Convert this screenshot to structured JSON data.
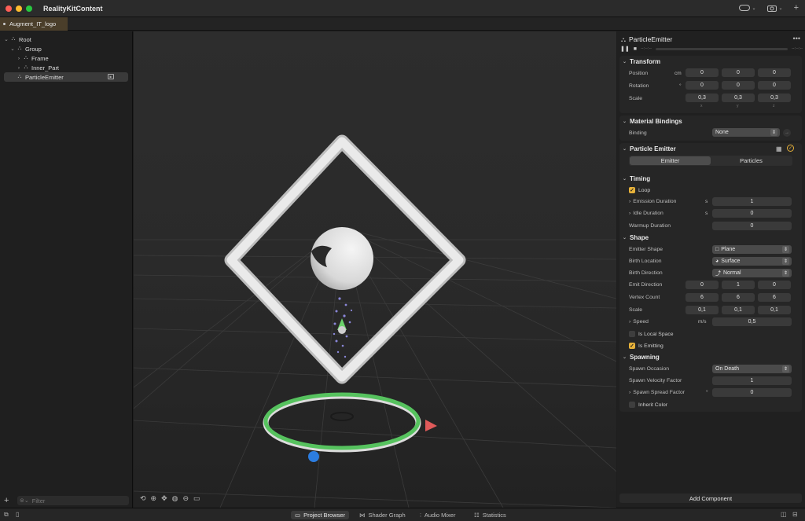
{
  "window": {
    "title": "RealityKitContent",
    "colors": {
      "close": "#ff5f57",
      "minimize": "#febc2e",
      "zoom": "#28c840",
      "accent": "#e6b13a",
      "tab_bg": "#4a3e2a"
    },
    "toolbar_icons": [
      "vr-headset-icon",
      "camera-icon",
      "plus-icon"
    ]
  },
  "tab": {
    "label": "Augment_IT_logo"
  },
  "hierarchy": {
    "items": [
      {
        "label": "Root",
        "expanded": true,
        "icon": "entity-icon"
      },
      {
        "label": "Group",
        "expanded": true,
        "icon": "entity-icon"
      },
      {
        "label": "Frame",
        "expanded": false,
        "icon": "entity-icon"
      },
      {
        "label": "Inner_Part",
        "expanded": false,
        "icon": "model-icon"
      },
      {
        "label": "ParticleEmitter",
        "selected": true,
        "icon": "entity-icon"
      }
    ],
    "filter_placeholder": "Filter"
  },
  "viewport": {
    "tools": [
      "orbit-icon",
      "move-icon",
      "pan-icon",
      "globe-icon",
      "zoom-icon",
      "camera-icon"
    ]
  },
  "inspector": {
    "title": "ParticleEmitter",
    "time_start": "--:--:--",
    "time_end": "--:--:--",
    "transform": {
      "title": "Transform",
      "position": {
        "label": "Position",
        "unit": "cm",
        "values": [
          "0",
          "0",
          "0"
        ]
      },
      "rotation": {
        "label": "Rotation",
        "unit": "°",
        "values": [
          "0",
          "0",
          "0"
        ]
      },
      "scale": {
        "label": "Scale",
        "values": [
          "0,3",
          "0,3",
          "0,3"
        ]
      },
      "axes": [
        "x",
        "y",
        "z"
      ]
    },
    "material": {
      "title": "Material Bindings",
      "binding_label": "Binding",
      "binding_value": "None"
    },
    "particle": {
      "title": "Particle Emitter",
      "segments": [
        "Emitter",
        "Particles"
      ],
      "active_segment": "Emitter",
      "timing": {
        "title": "Timing",
        "loop_label": "Loop",
        "loop": true,
        "emission_label": "Emission Duration",
        "emission_unit": "s",
        "emission_value": "1",
        "idle_label": "Idle Duration",
        "idle_unit": "s",
        "idle_value": "0",
        "warmup_label": "Warmup Duration",
        "warmup_value": "0"
      },
      "shape": {
        "title": "Shape",
        "emitter_shape_label": "Emitter Shape",
        "emitter_shape_value": "Plane",
        "birth_location_label": "Birth Location",
        "birth_location_value": "Surface",
        "birth_direction_label": "Birth Direction",
        "birth_direction_value": "Normal",
        "emit_direction_label": "Emit Direction",
        "emit_direction_values": [
          "0",
          "1",
          "0"
        ],
        "vertex_count_label": "Vertex Count",
        "vertex_count_values": [
          "6",
          "6",
          "6"
        ],
        "scale_label": "Scale",
        "scale_values": [
          "0,1",
          "0,1",
          "0,1"
        ],
        "speed_label": "Speed",
        "speed_unit": "m/s",
        "speed_value": "0,5",
        "local_space_label": "Is Local Space",
        "local_space": false,
        "emitting_label": "Is Emitting",
        "emitting": true
      },
      "spawning": {
        "title": "Spawning",
        "occasion_label": "Spawn Occasion",
        "occasion_value": "On Death",
        "velocity_label": "Spawn Velocity Factor",
        "velocity_value": "1",
        "spread_label": "Spawn Spread Factor",
        "spread_unit": "°",
        "spread_value": "0",
        "inherit_label": "Inherit Color",
        "inherit": false
      }
    },
    "add_component": "Add Component"
  },
  "bottom": {
    "tabs": [
      {
        "label": "Project Browser",
        "active": true
      },
      {
        "label": "Shader Graph"
      },
      {
        "label": "Audio Mixer"
      },
      {
        "label": "Statistics"
      }
    ]
  }
}
